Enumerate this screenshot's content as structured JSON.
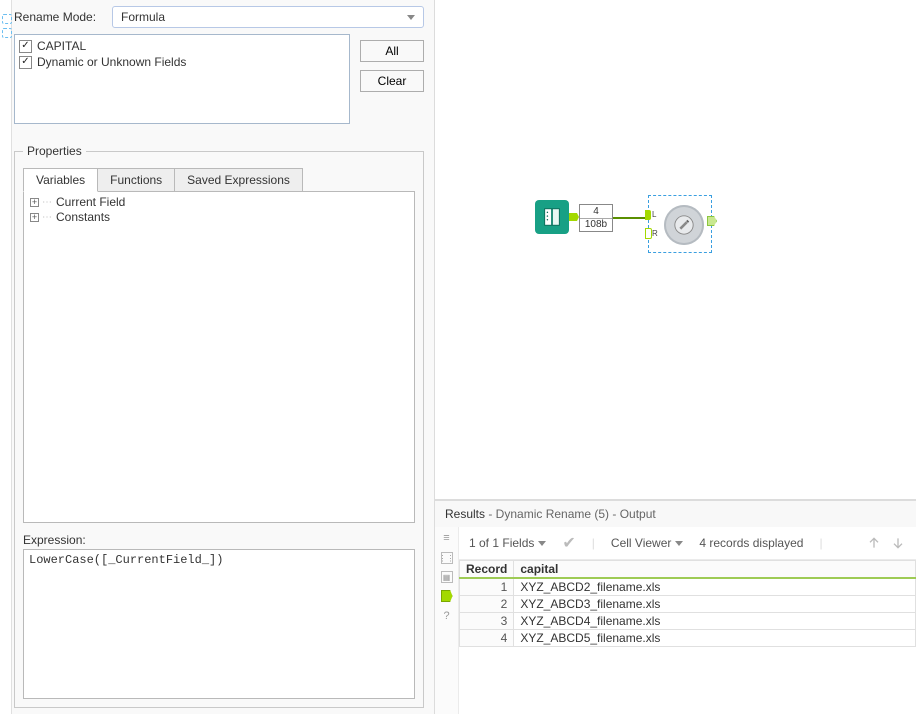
{
  "config": {
    "rename_mode_label": "Rename Mode:",
    "rename_mode_value": "Formula",
    "fields": [
      {
        "label": "CAPITAL",
        "checked": true
      },
      {
        "label": "Dynamic or Unknown Fields",
        "checked": true
      }
    ],
    "all_button": "All",
    "clear_button": "Clear"
  },
  "properties": {
    "legend": "Properties",
    "tabs": [
      {
        "label": "Variables",
        "active": true
      },
      {
        "label": "Functions",
        "active": false
      },
      {
        "label": "Saved Expressions",
        "active": false
      }
    ],
    "tree": [
      "Current Field",
      "Constants"
    ],
    "expression_label": "Expression:",
    "expression_value": "LowerCase([_CurrentField_])"
  },
  "canvas": {
    "input_icon": "book-icon",
    "info_rows": "4",
    "info_bytes": "108b",
    "rename_tool": "dynamic-rename-icon",
    "rename_port_left": "L",
    "rename_port_right": "R"
  },
  "results": {
    "title": "Results",
    "subtitle": " - Dynamic Rename (5) - Output",
    "fields_dd": "1 of 1 Fields",
    "viewer_dd": "Cell Viewer",
    "records_text": "4 records displayed",
    "table": {
      "headers": [
        "Record",
        "capital"
      ],
      "rows": [
        [
          "1",
          "XYZ_ABCD2_filename.xls"
        ],
        [
          "2",
          "XYZ_ABCD3_filename.xls"
        ],
        [
          "3",
          "XYZ_ABCD4_filename.xls"
        ],
        [
          "4",
          "XYZ_ABCD5_filename.xls"
        ]
      ]
    }
  }
}
